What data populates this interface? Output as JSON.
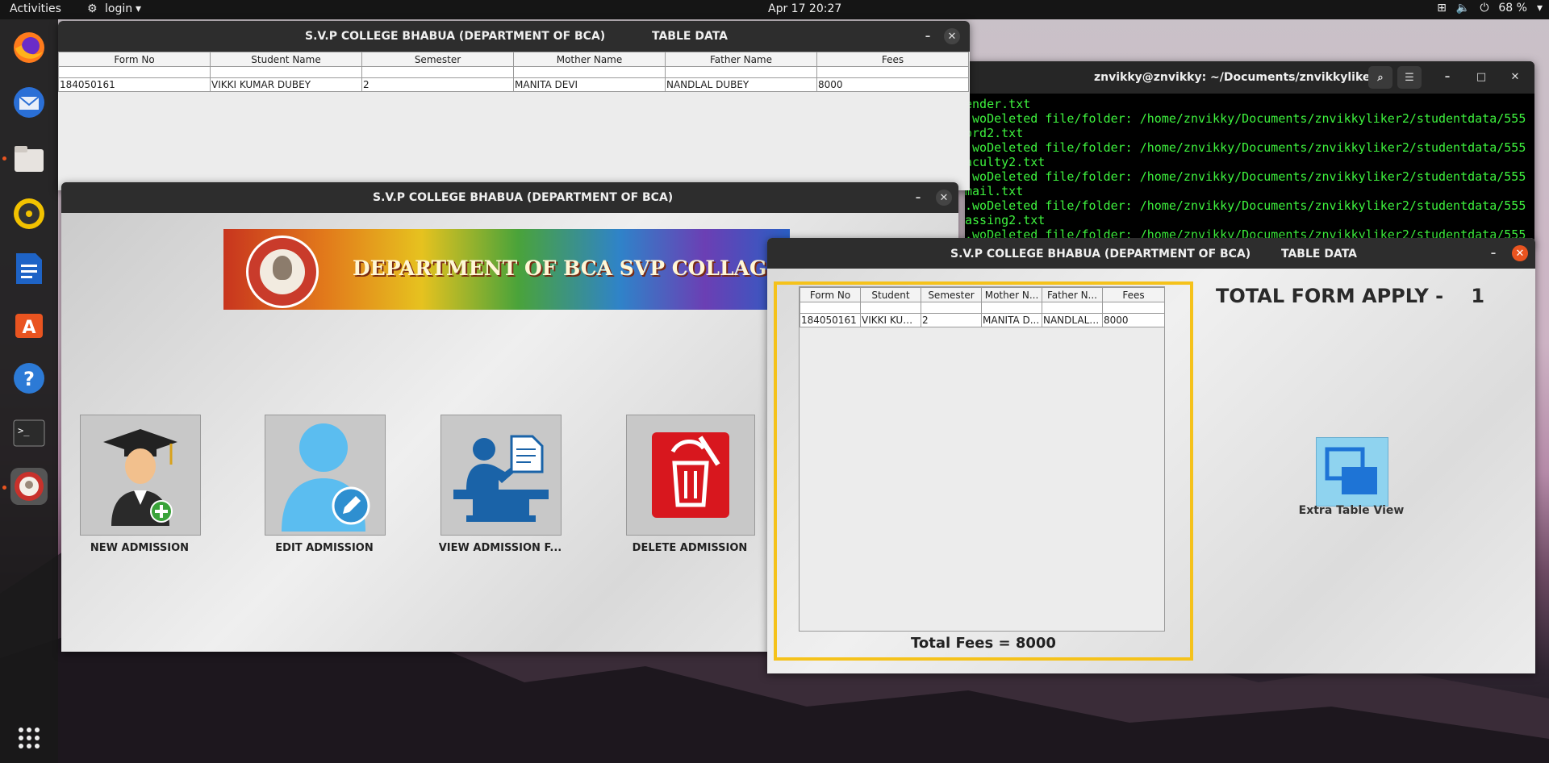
{
  "topbar": {
    "activities": "Activities",
    "app_menu": "login",
    "clock": "Apr 17  20:27",
    "battery": "68 %"
  },
  "table_window": {
    "title": "S.V.P COLLEGE BHABUA (DEPARTMENT OF BCA)",
    "subtitle": "TABLE DATA",
    "columns": [
      "Form No",
      "Student Name",
      "Semester",
      "Mother Name",
      "Father Name",
      "Fees"
    ],
    "rows": [
      [
        "184050161",
        "VIKKI KUMAR DUBEY",
        "2",
        "MANITA DEVI",
        "NANDLAL DUBEY",
        "8000"
      ]
    ]
  },
  "terminal": {
    "title": "znvikky@znvikky: ~/Documents/znvikkyliker2",
    "lines": [
      "ender.txt",
      ".woDeleted file/folder: /home/znvikky/Documents/znvikkyliker2/studentdata/555",
      "ord2.txt",
      ".woDeleted file/folder: /home/znvikky/Documents/znvikkyliker2/studentdata/555",
      "aculty2.txt",
      ".woDeleted file/folder: /home/znvikky/Documents/znvikkyliker2/studentdata/555",
      "mail.txt",
      ".woDeleted file/folder: /home/znvikky/Documents/znvikkyliker2/studentdata/555",
      "assing2.txt",
      ".woDeleted file/folder: /home/znvikky/Documents/znvikkyliker2/studentdata/555"
    ]
  },
  "main_window": {
    "title": "S.V.P COLLEGE BHABUA (DEPARTMENT OF BCA)",
    "banner_text": "DEPARTMENT OF BCA SVP COLLAGE BHABUA",
    "buttons": [
      {
        "label": "NEW ADMISSION",
        "icon": "graduate-add-icon"
      },
      {
        "label": "EDIT ADMISSION",
        "icon": "user-edit-icon"
      },
      {
        "label": "VIEW ADMISSION F...",
        "icon": "presenter-document-icon"
      },
      {
        "label": "DELETE ADMISSION",
        "icon": "trash-icon"
      }
    ]
  },
  "summary_window": {
    "title": "S.V.P COLLEGE BHABUA (DEPARTMENT OF BCA)",
    "subtitle": "TABLE DATA",
    "columns": [
      "Form No",
      "Student",
      "Semester",
      "Mother N...",
      "Father N...",
      "Fees"
    ],
    "rows": [
      [
        "184050161",
        "VIKKI KUM...",
        "2",
        "MANITA D...",
        "NANDLAL ...",
        "8000"
      ]
    ],
    "total_form_label": "TOTAL FORM APPLY -",
    "total_form_value": "1",
    "total_fees_label": "Total Fees =",
    "total_fees_value": "8000",
    "extra_view_label": "Extra Table View",
    "accent_color": "#f5c21b"
  }
}
